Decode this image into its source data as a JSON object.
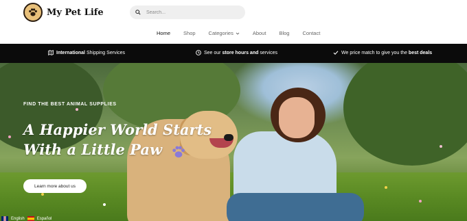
{
  "brand": {
    "name": "My Pet Life",
    "logo_icon": "paw-icon",
    "accent": "#e8c07a"
  },
  "search": {
    "placeholder": "Search..."
  },
  "nav": {
    "items": [
      {
        "label": "Home",
        "active": true
      },
      {
        "label": "Shop"
      },
      {
        "label": "Categories",
        "has_dropdown": true
      },
      {
        "label": "About"
      },
      {
        "label": "Blog"
      },
      {
        "label": "Contact"
      }
    ]
  },
  "infobar": {
    "shipping": {
      "bold": "International",
      "rest": " Shipping Services",
      "icon": "map-icon"
    },
    "hours": {
      "pre": "See our ",
      "bold": "store hours and",
      "rest": " services",
      "icon": "clock-icon"
    },
    "price": {
      "pre": "We price match to give you the ",
      "bold": "best deals",
      "icon": "check-icon"
    }
  },
  "hero": {
    "eyebrow": "FIND THE BEST ANIMAL SUPPLIES",
    "headline_line1": "A Happier World Starts",
    "headline_line2": "With a Little Paw",
    "cta_label": "Learn more about us"
  },
  "language": {
    "items": [
      "English",
      "Español"
    ]
  }
}
